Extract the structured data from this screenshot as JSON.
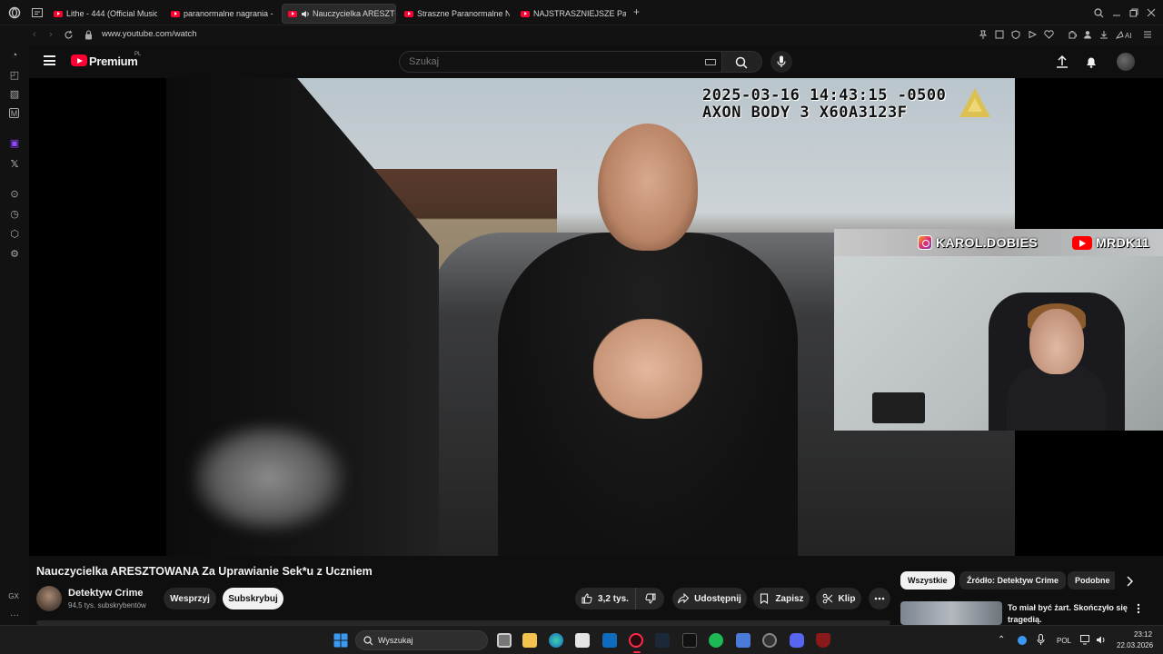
{
  "browser": {
    "tabs": [
      {
        "label": "Lithe - 444 (Official Music"
      },
      {
        "label": "paranormalne nagrania - Y"
      },
      {
        "label": "Nauczycielka ARESZTO"
      },
      {
        "label": "Straszne Paranormalne Na"
      },
      {
        "label": "NAJSTRASZNIEJSZE Paran"
      }
    ],
    "new_tab": "+",
    "url": "www.youtube.com/watch"
  },
  "sidebar": {
    "gx_label": "GX",
    "more_label": "···"
  },
  "youtube": {
    "logo_text": "Premium",
    "logo_region": "PL",
    "search_placeholder": "Szukaj"
  },
  "video": {
    "timestamp_line1": "2025-03-16 14:43:15 -0500",
    "timestamp_line2": "AXON BODY 3 X60A3123F",
    "overlay_instagram": "KAROL.DOBIES",
    "overlay_youtube": "MRDK11",
    "title": "Nauczycielka ARESZTOWANA Za Uprawianie Sek*u z Uczniem"
  },
  "channel": {
    "name": "Detektyw Crime",
    "subscribers": "94,5 tys. subskrybentów",
    "support_label": "Wesprzyj",
    "subscribe_label": "Subskrybuj"
  },
  "actions": {
    "likes": "3,2 tys.",
    "share": "Udostępnij",
    "save": "Zapisz",
    "clip": "Klip"
  },
  "filters": {
    "chips": [
      "Wszystkie",
      "Źródło: Detektyw Crime",
      "Podobne"
    ]
  },
  "recommendation": {
    "title": "To miał być żart. Skończyło się tragedią."
  },
  "taskbar": {
    "search_label": "Wyszukaj",
    "language": "POL",
    "time": "23:12",
    "date": "22.03.2026"
  },
  "colors": {
    "youtube_red": "#ff0033",
    "background": "#0f0f0f"
  }
}
